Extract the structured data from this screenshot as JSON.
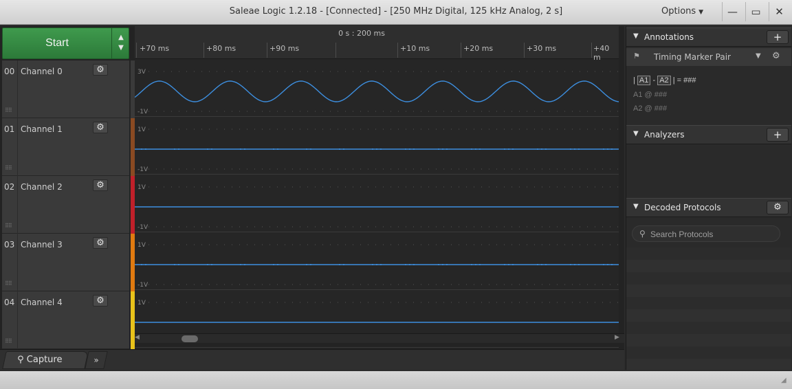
{
  "window": {
    "title": "Saleae Logic 1.2.18 - [Connected] - [250 MHz Digital, 125 kHz Analog, 2 s]",
    "options_label": "Options",
    "minimize_glyph": "—",
    "maximize_glyph": "▭",
    "close_glyph": "✕"
  },
  "capture": {
    "start_label": "Start",
    "tab_label": "Capture",
    "more_glyph": "»"
  },
  "timeline": {
    "center_time": "0 s : 200 ms",
    "ticks": [
      "+70 ms",
      "+80 ms",
      "+90 ms",
      "+10 ms",
      "+20 ms",
      "+30 ms",
      "+40 m"
    ]
  },
  "channels": [
    {
      "num": "00",
      "name": "Channel 0",
      "color": "#3a3a3a",
      "vtop": "3V",
      "vbot": "-1V",
      "signal": "sine"
    },
    {
      "num": "01",
      "name": "Channel 1",
      "color": "#8a4a22",
      "vtop": "1V",
      "vbot": "-1V",
      "signal": "flat-noisy"
    },
    {
      "num": "02",
      "name": "Channel 2",
      "color": "#c0202a",
      "vtop": "1V",
      "vbot": "-1V",
      "signal": "flat"
    },
    {
      "num": "03",
      "name": "Channel 3",
      "color": "#e07a10",
      "vtop": "1V",
      "vbot": "-1V",
      "signal": "flat-noisy"
    },
    {
      "num": "04",
      "name": "Channel 4",
      "color": "#e8c21a",
      "vtop": "1V",
      "vbot": "",
      "signal": "flat"
    }
  ],
  "signal_color": "#3d8fe0",
  "annotations": {
    "title": "Annotations",
    "marker_pair": "Timing Marker Pair",
    "a1": "A1",
    "a2": "A2",
    "formula_sep": "-",
    "formula_rhs": "= ###",
    "a1_line": "A1  @  ###",
    "a2_line": "A2  @  ###"
  },
  "analyzers": {
    "title": "Analyzers"
  },
  "decoded": {
    "title": "Decoded Protocols",
    "search_placeholder": "Search Protocols"
  }
}
